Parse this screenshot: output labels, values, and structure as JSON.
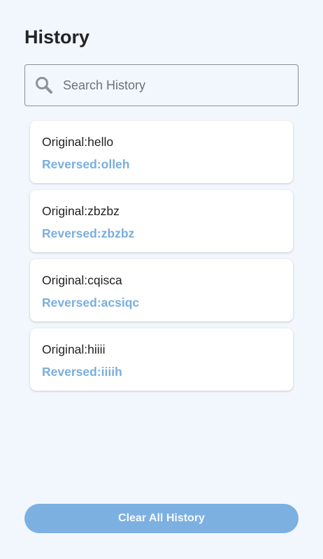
{
  "header": {
    "title": "History"
  },
  "search": {
    "placeholder": "Search History",
    "value": ""
  },
  "history": [
    {
      "original_label": "Original: ",
      "original": "hello",
      "reversed_label": "Reversed: ",
      "reversed": "olleh"
    },
    {
      "original_label": "Original: ",
      "original": "zbzbz",
      "reversed_label": "Reversed: ",
      "reversed": "zbzbz"
    },
    {
      "original_label": "Original: ",
      "original": "cqisca",
      "reversed_label": "Reversed: ",
      "reversed": "acsiqc"
    },
    {
      "original_label": "Original: ",
      "original": "hiiii",
      "reversed_label": "Reversed: ",
      "reversed": "iiiih"
    }
  ],
  "footer": {
    "clear_label": "Clear All History"
  },
  "icons": {
    "search": "search-icon"
  },
  "colors": {
    "accent": "#7cb0e0",
    "reversed_text": "#79aee0",
    "background": "#f2f7fd"
  }
}
